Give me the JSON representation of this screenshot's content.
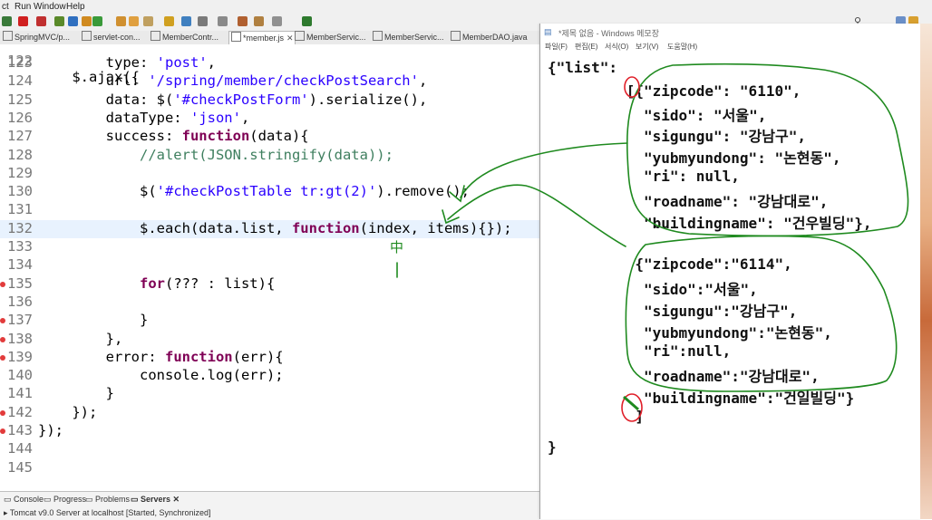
{
  "menu": {
    "items": [
      "ct",
      "Run",
      "Window",
      "Help"
    ]
  },
  "editor_tabs": [
    {
      "label": "SpringMVC/p..."
    },
    {
      "label": "servlet-con..."
    },
    {
      "label": "MemberContr..."
    },
    {
      "label": "*member.js",
      "active": true
    },
    {
      "label": "MemberServic..."
    },
    {
      "label": "MemberServic..."
    },
    {
      "label": "MemberDAO.java"
    }
  ],
  "code": {
    "partial_top": "$.ajax({",
    "lines": [
      {
        "n": "123",
        "t": "        type: 'post',"
      },
      {
        "n": "124",
        "t": "        url: '/spring/member/checkPostSearch',"
      },
      {
        "n": "125",
        "t": "        data: $('#checkPostForm').serialize(),"
      },
      {
        "n": "126",
        "t": "        dataType: 'json',"
      },
      {
        "n": "127",
        "t": "        success: function(data){"
      },
      {
        "n": "128",
        "t": "            //alert(JSON.stringify(data));"
      },
      {
        "n": "129",
        "t": ""
      },
      {
        "n": "130",
        "t": "            $('#checkPostTable tr:gt(2)').remove();"
      },
      {
        "n": "131",
        "t": ""
      },
      {
        "n": "132",
        "t": "            $.each(data.list, function(index, items){});"
      },
      {
        "n": "133",
        "t": ""
      },
      {
        "n": "134",
        "t": ""
      },
      {
        "n": "135",
        "t": "            for(??? : list){"
      },
      {
        "n": "136",
        "t": ""
      },
      {
        "n": "137",
        "t": "            }"
      },
      {
        "n": "138",
        "t": "        },"
      },
      {
        "n": "139",
        "t": "        error: function(err){"
      },
      {
        "n": "140",
        "t": "            console.log(err);"
      },
      {
        "n": "141",
        "t": "        }"
      },
      {
        "n": "142",
        "t": "    });"
      },
      {
        "n": "143",
        "t": "});"
      },
      {
        "n": "144",
        "t": ""
      },
      {
        "n": "145",
        "t": ""
      }
    ]
  },
  "bottom_panel": {
    "tabs": [
      "Console",
      "Progress",
      "Problems",
      "Servers"
    ],
    "server_entry": "Tomcat v9.0 Server at localhost  [Started, Synchronized]"
  },
  "notepad": {
    "title": "*제목 없음 - Windows 메모장",
    "menu": [
      "파일(F)",
      "편집(E)",
      "서식(O)",
      "보기(V)",
      "도움말(H)"
    ],
    "lines": [
      "{\"list\":",
      "         [{\"zipcode\": \"6110\",",
      "           \"sido\": \"서울\",",
      "           \"sigungu\": \"강남구\",",
      "           \"yubmyundong\": \"논현동\",",
      "           \"ri\": null,",
      "           \"roadname\": \"강남대로\",",
      "           \"buildingname\": \"건우빌딩\"},",
      "",
      "          {\"zipcode\":\"6114\",",
      "           \"sido\":\"서울\",",
      "           \"sigungu\":\"강남구\",",
      "           \"yubmyundong\":\"논현동\",",
      "           \"ri\":null,",
      "           \"roadname\":\"강남대로\",",
      "           \"buildingname\":\"건일빌딩\"}",
      "          ]",
      "}"
    ]
  },
  "annotation": {
    "handwritten_char": "中"
  },
  "colors": {
    "annotation_green": "#1f8a1f",
    "annotation_red": "#e0202a",
    "keyword": "#7f0055",
    "string": "#2a00ff",
    "comment": "#3f7f5f"
  }
}
